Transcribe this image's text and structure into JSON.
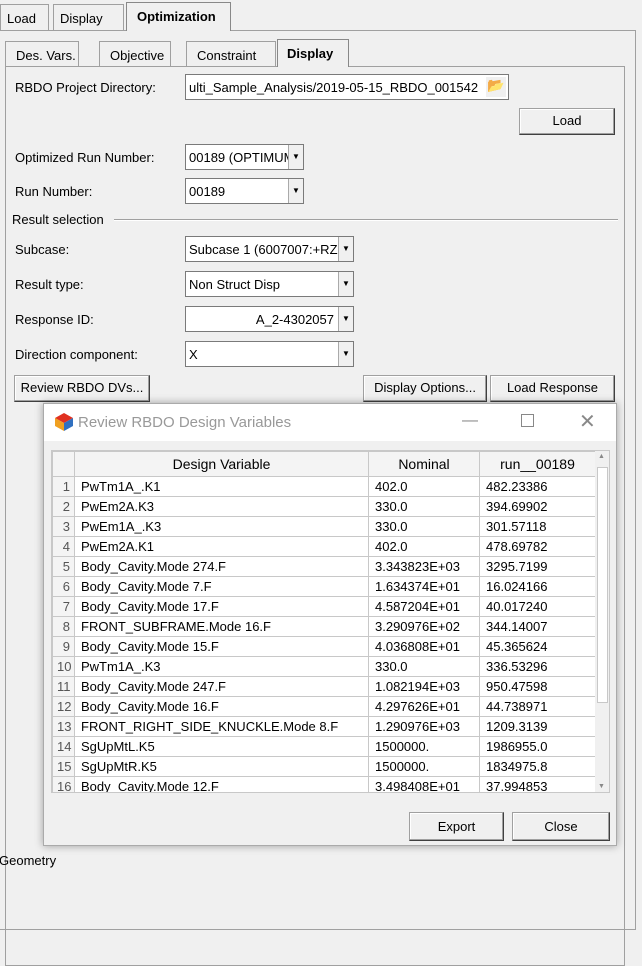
{
  "main_tabs": [
    "Load",
    "Display",
    "Optimization"
  ],
  "sub_tabs": [
    "Des. Vars.",
    "Objective",
    "Constraint",
    "Display"
  ],
  "form": {
    "project_dir_label": "RBDO Project Directory:",
    "project_dir_value": "ulti_Sample_Analysis/2019-05-15_RBDO_001542",
    "load_button": "Load",
    "optimized_run_label": "Optimized Run Number:",
    "optimized_run_value": "00189 (OPTIMUM",
    "run_number_label": "Run Number:",
    "run_number_value": "00189",
    "result_selection_label": "Result selection",
    "subcase_label": "Subcase:",
    "subcase_value": "Subcase 1 (6007007:+RZ",
    "result_type_label": "Result type:",
    "result_type_value": "Non Struct Disp",
    "response_id_label": "Response ID:",
    "response_id_value": "A_2-4302057",
    "direction_label": "Direction component:",
    "direction_value": "X",
    "review_button": "Review RBDO DVs...",
    "display_options_button": "Display Options...",
    "load_response_button": "Load Response"
  },
  "dialog": {
    "title": "Review RBDO Design Variables",
    "columns": [
      "",
      "Design Variable",
      "Nominal",
      "run__00189"
    ],
    "rows": [
      [
        "1",
        "PwTm1A_.K1",
        "402.0",
        "482.23386"
      ],
      [
        "2",
        "PwEm2A.K3",
        "330.0",
        "394.69902"
      ],
      [
        "3",
        "PwEm1A_.K3",
        "330.0",
        "301.57118"
      ],
      [
        "4",
        "PwEm2A.K1",
        "402.0",
        "478.69782"
      ],
      [
        "5",
        "Body_Cavity.Mode 274.F",
        "3.343823E+03",
        "3295.7199"
      ],
      [
        "6",
        "Body_Cavity.Mode 7.F",
        "1.634374E+01",
        "16.024166"
      ],
      [
        "7",
        "Body_Cavity.Mode 17.F",
        "4.587204E+01",
        "40.017240"
      ],
      [
        "8",
        "FRONT_SUBFRAME.Mode 16.F",
        "3.290976E+02",
        "344.14007"
      ],
      [
        "9",
        "Body_Cavity.Mode 15.F",
        "4.036808E+01",
        "45.365624"
      ],
      [
        "10",
        "PwTm1A_.K3",
        "330.0",
        "336.53296"
      ],
      [
        "11",
        "Body_Cavity.Mode 247.F",
        "1.082194E+03",
        "950.47598"
      ],
      [
        "12",
        "Body_Cavity.Mode 16.F",
        "4.297626E+01",
        "44.738971"
      ],
      [
        "13",
        "FRONT_RIGHT_SIDE_KNUCKLE.Mode 8.F",
        "1.290976E+03",
        "1209.3139"
      ],
      [
        "14",
        "SgUpMtL.K5",
        "1500000.",
        "1986955.0"
      ],
      [
        "15",
        "SgUpMtR.K5",
        "1500000.",
        "1834975.8"
      ],
      [
        "16",
        "Body_Cavity.Mode 12.F",
        "3.498408E+01",
        "37.994853"
      ]
    ],
    "export_button": "Export",
    "close_button": "Close"
  },
  "footer_text": "Geometry"
}
